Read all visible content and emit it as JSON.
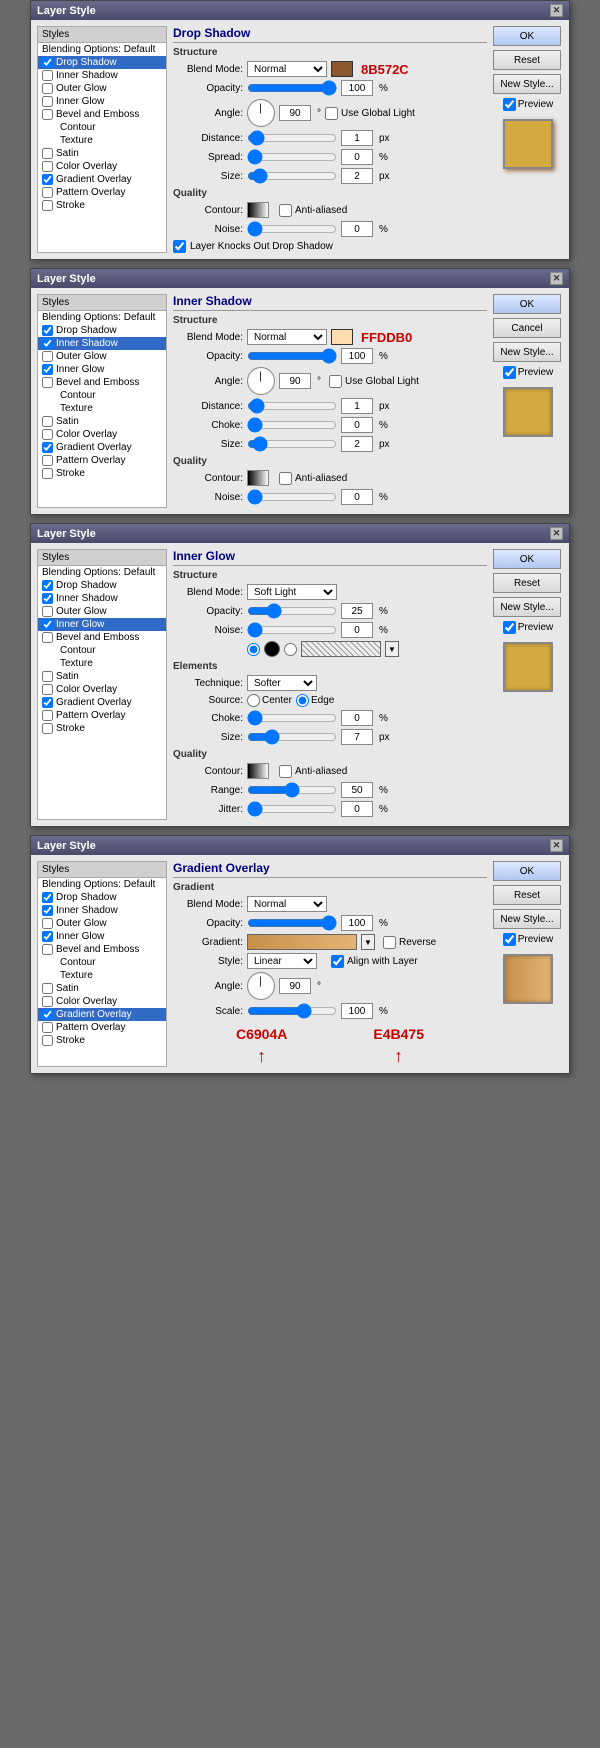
{
  "dialogs": [
    {
      "id": "drop-shadow",
      "title": "Layer Style",
      "section": "Drop Shadow",
      "subsection": "Structure",
      "blend_mode": "Normal",
      "color": "#8B572C",
      "color_hex_label": "8B572C",
      "opacity": 100,
      "angle": 90,
      "use_global_light": false,
      "distance": 1,
      "spread": 0,
      "size": 2,
      "quality_noise": 0,
      "layer_knocks_drop_shadow": true,
      "active_style": "Drop Shadow",
      "styles": [
        "Styles",
        "Blending Options: Default",
        "Drop Shadow",
        "Inner Shadow",
        "Outer Glow",
        "Inner Glow",
        "Bevel and Emboss",
        "Contour",
        "Texture",
        "Satin",
        "Color Overlay",
        "Gradient Overlay",
        "Pattern Overlay",
        "Stroke"
      ],
      "checked_styles": [
        "Drop Shadow",
        "Gradient Overlay"
      ],
      "buttons": [
        "OK",
        "Reset",
        "New Style..."
      ],
      "preview": true
    },
    {
      "id": "inner-shadow",
      "title": "Layer Style",
      "section": "Inner Shadow",
      "subsection": "Structure",
      "blend_mode": "Normal",
      "color": "#FFDDB0",
      "color_hex_label": "FFDDB0",
      "opacity": 100,
      "angle": 90,
      "use_global_light": false,
      "distance": 1,
      "choke": 0,
      "size": 2,
      "quality_noise": 0,
      "active_style": "Inner Shadow",
      "styles": [
        "Styles",
        "Blending Options: Default",
        "Drop Shadow",
        "Inner Shadow",
        "Outer Glow",
        "Inner Glow",
        "Bevel and Emboss",
        "Contour",
        "Texture",
        "Satin",
        "Color Overlay",
        "Gradient Overlay",
        "Pattern Overlay",
        "Stroke"
      ],
      "checked_styles": [
        "Drop Shadow",
        "Inner Shadow",
        "Inner Glow",
        "Gradient Overlay"
      ],
      "buttons": [
        "OK",
        "Cancel",
        "New Style..."
      ],
      "preview": true
    },
    {
      "id": "inner-glow",
      "title": "Layer Style",
      "section": "Inner Glow",
      "subsection": "Structure",
      "blend_mode": "Soft Light",
      "opacity": 25,
      "noise": 0,
      "technique": "Softer",
      "source_center": false,
      "source_edge": true,
      "choke": 0,
      "size": 7,
      "range": 50,
      "jitter": 0,
      "active_style": "Inner Glow",
      "styles": [
        "Styles",
        "Blending Options: Default",
        "Drop Shadow",
        "Inner Shadow",
        "Outer Glow",
        "Inner Glow",
        "Bevel and Emboss",
        "Contour",
        "Texture",
        "Satin",
        "Color Overlay",
        "Gradient Overlay",
        "Pattern Overlay",
        "Stroke"
      ],
      "checked_styles": [
        "Drop Shadow",
        "Inner Shadow",
        "Inner Glow",
        "Gradient Overlay"
      ],
      "buttons": [
        "OK",
        "Reset",
        "New Style..."
      ],
      "preview": true
    },
    {
      "id": "gradient-overlay",
      "title": "Layer Style",
      "section": "Gradient Overlay",
      "subsection": "Gradient",
      "blend_mode": "Normal",
      "opacity": 100,
      "style": "Linear",
      "align_with_layer": true,
      "angle": 90,
      "scale": 100,
      "reverse": false,
      "color_left": "#C6904A",
      "color_right": "#E4B475",
      "color_left_label": "C6904A",
      "color_right_label": "E4B475",
      "active_style": "Gradient Overlay",
      "styles": [
        "Styles",
        "Blending Options: Default",
        "Drop Shadow",
        "Inner Shadow",
        "Outer Glow",
        "Inner Glow",
        "Bevel and Emboss",
        "Contour",
        "Texture",
        "Satin",
        "Color Overlay",
        "Gradient Overlay",
        "Pattern Overlay",
        "Stroke"
      ],
      "checked_styles": [
        "Drop Shadow",
        "Inner Shadow",
        "Inner Glow",
        "Gradient Overlay"
      ],
      "buttons": [
        "OK",
        "Reset",
        "New Style..."
      ],
      "preview": true
    }
  ],
  "labels": {
    "styles_panel_title": "Styles",
    "blend_mode_label": "Blend Mode:",
    "opacity_label": "Opacity:",
    "angle_label": "Angle:",
    "distance_label": "Distance:",
    "spread_label": "Spread:",
    "choke_label": "Choke:",
    "size_label": "Size:",
    "noise_label": "Noise:",
    "quality_title": "Quality",
    "contour_label": "Contour:",
    "anti_aliased": "Anti-aliased",
    "layer_knocks": "Layer Knocks Out Drop Shadow",
    "use_global_light": "Use Global Light",
    "technique_label": "Technique:",
    "source_label": "Source:",
    "center_label": "Center",
    "edge_label": "Edge",
    "range_label": "Range:",
    "jitter_label": "Jitter:",
    "elements_title": "Elements",
    "gradient_label": "Gradient:",
    "style_label": "Style:",
    "align_layer": "Align with Layer",
    "scale_label": "Scale:",
    "reverse_label": "Reverse",
    "preview_label": "Preview"
  }
}
